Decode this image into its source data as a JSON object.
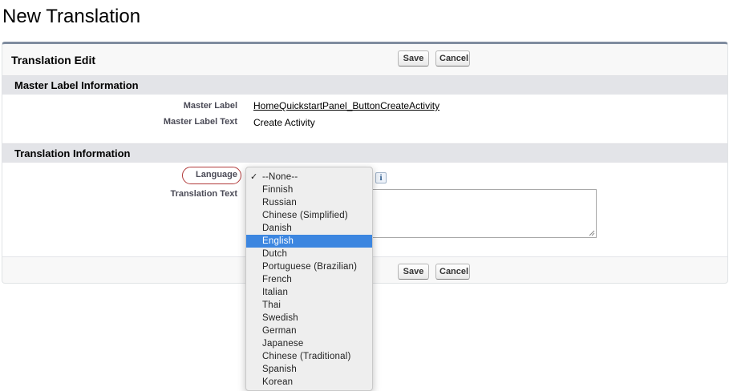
{
  "page": {
    "title": "New Translation"
  },
  "panel": {
    "title": "Translation Edit",
    "save_label": "Save",
    "cancel_label": "Cancel"
  },
  "master_section": {
    "title": "Master Label Information",
    "master_label_label": "Master Label",
    "master_label_value": "HomeQuickstartPanel_ButtonCreateActivity",
    "master_label_text_label": "Master Label Text",
    "master_label_text_value": "Create Activity"
  },
  "translation_section": {
    "title": "Translation Information",
    "language_label": "Language",
    "translation_text_label": "Translation Text",
    "info_icon": "i"
  },
  "language_dropdown": {
    "check_glyph": "✓",
    "checked_option": "--None--",
    "highlighted_option": "English",
    "options": [
      "--None--",
      "Finnish",
      "Russian",
      "Chinese (Simplified)",
      "Danish",
      "English",
      "Dutch",
      "Portuguese (Brazilian)",
      "French",
      "Italian",
      "Thai",
      "Swedish",
      "German",
      "Japanese",
      "Chinese (Traditional)",
      "Spanish",
      "Korean"
    ]
  },
  "colors": {
    "highlight": "#3c86e0",
    "panel_border": "#7f8c9f",
    "section_bg": "#e3e4e8",
    "annotation_oval": "#b13a3a"
  }
}
